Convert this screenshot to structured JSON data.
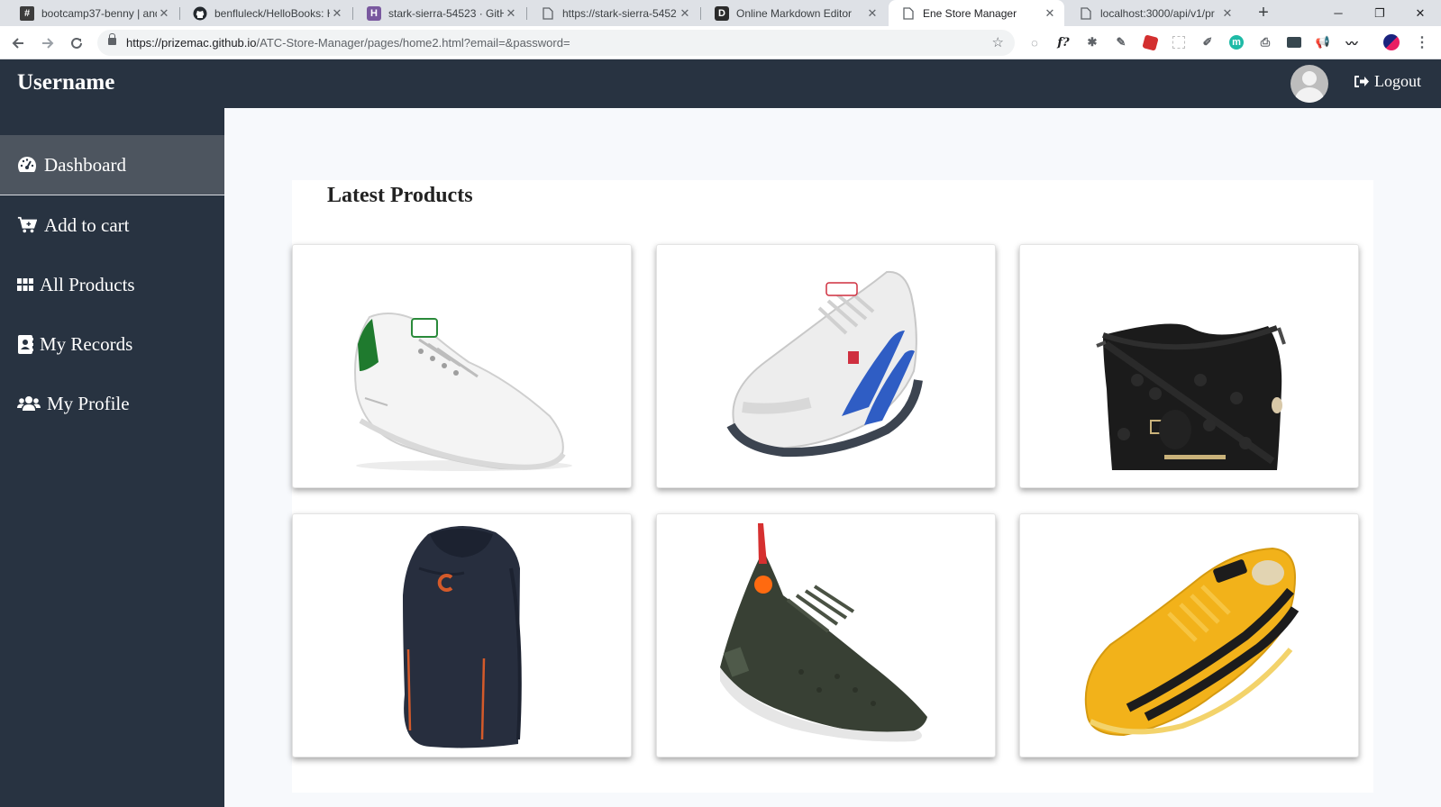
{
  "browser": {
    "tabs": [
      {
        "title": "bootcamp37-benny | and",
        "icon": "slack-hash-icon",
        "active": false
      },
      {
        "title": "benfluleck/HelloBooks: H",
        "icon": "github-icon",
        "active": false
      },
      {
        "title": "stark-sierra-54523 · GitH",
        "icon": "heroku-icon",
        "active": false
      },
      {
        "title": "https://stark-sierra-5452",
        "icon": "page-icon",
        "active": false
      },
      {
        "title": "Online Markdown Editor",
        "icon": "dillinger-icon",
        "active": false
      },
      {
        "title": "Ene Store Manager",
        "icon": "page-icon",
        "active": true
      },
      {
        "title": "localhost:3000/api/v1/pr",
        "icon": "page-icon",
        "active": false
      }
    ],
    "url_host": "https://prizemac.github.io",
    "url_path": "/ATC-Store-Manager/pages/home2.html?email=&password="
  },
  "header": {
    "brand": "Username",
    "logout_label": "Logout"
  },
  "sidebar": {
    "items": [
      {
        "label": "Dashboard",
        "icon": "dashboard-gauge-icon",
        "active": true
      },
      {
        "label": "Add to cart",
        "icon": "cart-plus-icon",
        "active": false
      },
      {
        "label": "All Products",
        "icon": "grid-icon",
        "active": false
      },
      {
        "label": "My Records",
        "icon": "address-book-icon",
        "active": false
      },
      {
        "label": "My Profile",
        "icon": "users-icon",
        "active": false
      }
    ]
  },
  "main": {
    "section_title": "Latest Products",
    "products": [
      {
        "image": "white-green-sneaker"
      },
      {
        "image": "grey-blue-runner-sneaker"
      },
      {
        "image": "black-croc-crossbody-bag"
      },
      {
        "image": "navy-hooded-vest"
      },
      {
        "image": "olive-knit-sneaker"
      },
      {
        "image": "yellow-black-sneaker"
      }
    ]
  },
  "colors": {
    "header_bg": "#283341",
    "sidebar_bg": "#283341",
    "sidebar_active_bg": "#4d555f",
    "page_bg": "#f7f9fc"
  }
}
